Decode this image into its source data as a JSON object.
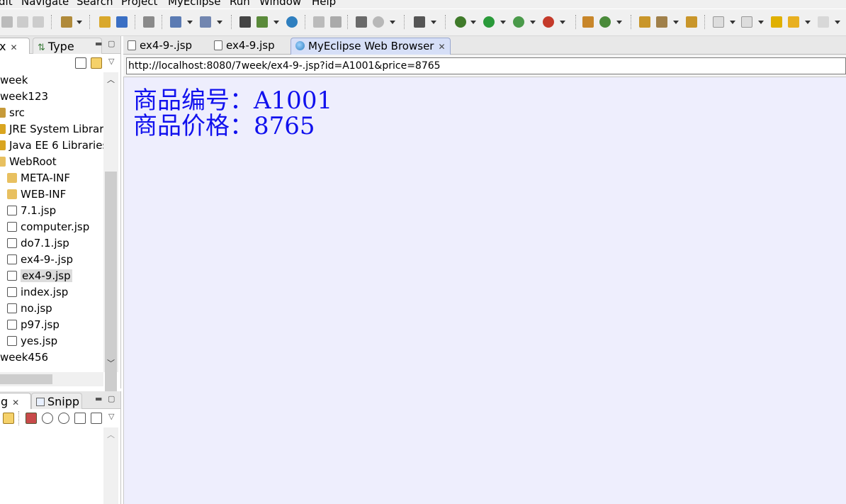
{
  "window": {
    "menu": [
      "dit",
      "Navigate",
      "Search",
      "Project",
      "MyEclipse",
      "Run",
      "Window",
      "Help"
    ]
  },
  "package_view": {
    "tabs": [
      {
        "label": "x",
        "active": true
      },
      {
        "label": "Type",
        "active": false
      }
    ],
    "tree": [
      {
        "label": "week",
        "icon": "project-icon"
      },
      {
        "label": "week123",
        "icon": "project-icon"
      },
      {
        "label": "src",
        "icon": "source-folder-icon"
      },
      {
        "label": "JRE System Library",
        "icon": "library-icon"
      },
      {
        "label": "Java EE 6 Libraries",
        "icon": "library-icon"
      },
      {
        "label": "WebRoot",
        "icon": "folder-icon"
      },
      {
        "label": "META-INF",
        "icon": "folder-icon"
      },
      {
        "label": "WEB-INF",
        "icon": "folder-icon"
      },
      {
        "label": "7.1.jsp",
        "icon": "jsp-file-icon"
      },
      {
        "label": "computer.jsp",
        "icon": "jsp-file-icon"
      },
      {
        "label": "do7.1.jsp",
        "icon": "jsp-file-icon"
      },
      {
        "label": "ex4-9-.jsp",
        "icon": "jsp-file-icon"
      },
      {
        "label": "ex4-9.jsp",
        "icon": "jsp-file-icon",
        "selected": true
      },
      {
        "label": "index.jsp",
        "icon": "jsp-file-icon"
      },
      {
        "label": "no.jsp",
        "icon": "jsp-file-icon"
      },
      {
        "label": "p97.jsp",
        "icon": "jsp-file-icon"
      },
      {
        "label": "yes.jsp",
        "icon": "jsp-file-icon"
      },
      {
        "label": "week456",
        "icon": "project-icon"
      }
    ]
  },
  "bottom_view": {
    "tabs": [
      {
        "label": "g",
        "active": true
      },
      {
        "label": "Snipp",
        "active": false
      }
    ]
  },
  "editor": {
    "tabs": [
      {
        "label": "ex4-9-.jsp",
        "icon": "jsp-file-icon",
        "active": false
      },
      {
        "label": "ex4-9.jsp",
        "icon": "jsp-file-icon",
        "active": false
      },
      {
        "label": "MyEclipse Web Browser",
        "icon": "globe-icon",
        "active": true
      }
    ],
    "browser": {
      "url": "http://localhost:8080/7week/ex4-9-.jsp?id=A1001&price=8765",
      "lines": [
        "商品编号：A1001",
        "商品价格：8765"
      ]
    }
  }
}
